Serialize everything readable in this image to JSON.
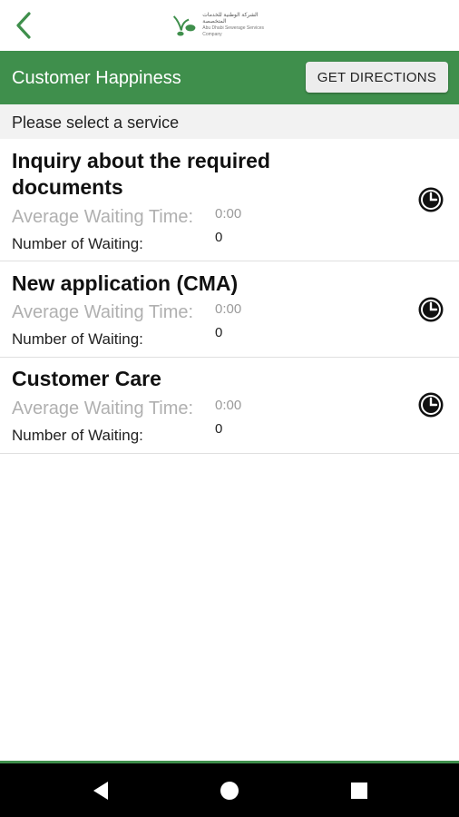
{
  "header": {
    "title": "Customer Happiness",
    "directions_button": "GET DIRECTIONS"
  },
  "subheader": {
    "text": "Please select a service"
  },
  "logo": {
    "arabic": "الشركة الوطنية للخدمات المتخصصة",
    "english": "Abu Dhabi Sewerage Services Company"
  },
  "labels": {
    "avg_wait": "Average Waiting Time:",
    "num_waiting": "Number of Waiting:"
  },
  "services": [
    {
      "title": "Inquiry about the required documents",
      "avg_time": "0:00",
      "waiting": "0"
    },
    {
      "title": "New application (CMA)",
      "avg_time": "0:00",
      "waiting": "0"
    },
    {
      "title": "Customer Care",
      "avg_time": "0:00",
      "waiting": "0"
    }
  ],
  "colors": {
    "brand_green": "#3f8f4c"
  },
  "icons": {
    "back": "chevron-left-icon",
    "clock": "clock-icon",
    "nav_back": "triangle-back-icon",
    "nav_home": "circle-home-icon",
    "nav_recents": "square-recents-icon"
  }
}
